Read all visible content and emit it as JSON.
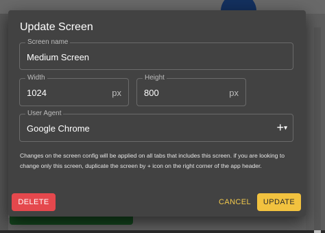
{
  "dialog": {
    "title": "Update Screen",
    "fields": {
      "name": {
        "label": "Screen name",
        "value": "Medium Screen"
      },
      "width": {
        "label": "Width",
        "value": "1024",
        "unit": "px"
      },
      "height": {
        "label": "Height",
        "value": "800",
        "unit": "px"
      },
      "user_agent": {
        "label": "User Agent",
        "value": "Google Chrome"
      }
    },
    "help": "Changes on the screen config will be applied on all tabs that includes this screen. if you are looking to change only this screen, duplicate the screen by + icon on the right corner of the app header.",
    "buttons": {
      "delete": "DELETE",
      "cancel": "CANCEL",
      "update": "UPDATE"
    }
  },
  "icons": {
    "add": "+",
    "dropdown": "▾"
  },
  "colors": {
    "dialog_bg": "#424242",
    "delete": "#e5484d",
    "update": "#f2c23f",
    "cancel_text": "#f2c94c"
  }
}
